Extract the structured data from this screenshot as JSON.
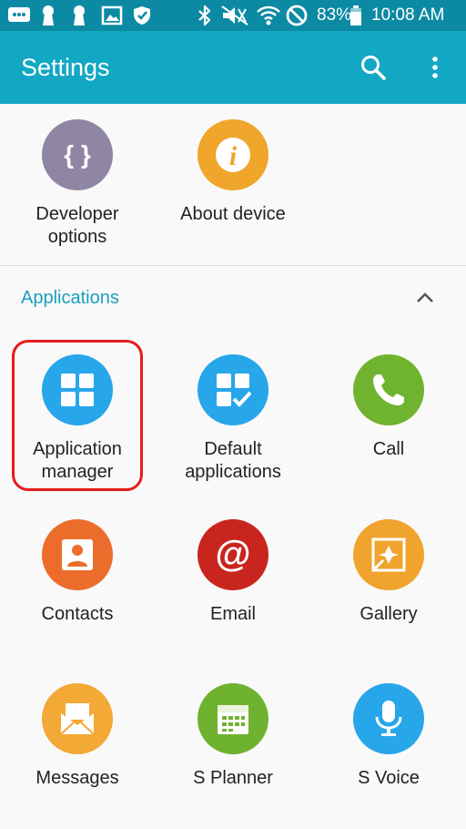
{
  "status_bar": {
    "battery": "83%",
    "time": "10:08 AM",
    "icons": [
      "message-icon",
      "keyhole-icon",
      "keyhole-icon",
      "image-icon",
      "shield-icon",
      "bluetooth-icon",
      "mute-icon",
      "wifi-icon",
      "blocked-icon",
      "battery-icon"
    ]
  },
  "app_bar": {
    "title": "Settings",
    "actions": [
      "search-icon",
      "more-vert-icon"
    ]
  },
  "system_tiles": [
    {
      "label": "Developer options",
      "icon": "developer-options-icon",
      "color": "#8e86a3"
    },
    {
      "label": "About device",
      "icon": "about-device-icon",
      "color": "#efa62b"
    }
  ],
  "applications_section": {
    "title": "Applications",
    "toggle_icon": "chevron-up-icon",
    "tiles": [
      {
        "label": "Application manager",
        "icon": "application-manager-icon",
        "color": "#27a6ea",
        "highlighted": true
      },
      {
        "label": "Default applications",
        "icon": "default-applications-icon",
        "color": "#27a6ea"
      },
      {
        "label": "Call",
        "icon": "call-icon",
        "color": "#70b32e"
      },
      {
        "label": "Contacts",
        "icon": "contacts-icon",
        "color": "#ec6d2b"
      },
      {
        "label": "Email",
        "icon": "email-icon",
        "color": "#c9251f"
      },
      {
        "label": "Gallery",
        "icon": "gallery-icon",
        "color": "#f0a32d"
      },
      {
        "label": "Messages",
        "icon": "messages-icon",
        "color": "#f3a935"
      },
      {
        "label": "S Planner",
        "icon": "s-planner-icon",
        "color": "#6fb22f"
      },
      {
        "label": "S Voice",
        "icon": "s-voice-icon",
        "color": "#27a6ea"
      }
    ]
  },
  "colors": {
    "status_bar": "#0d8aa3",
    "app_bar": "#12a7c3",
    "section_title": "#1a9fbd",
    "highlight": "#e51c1c"
  }
}
